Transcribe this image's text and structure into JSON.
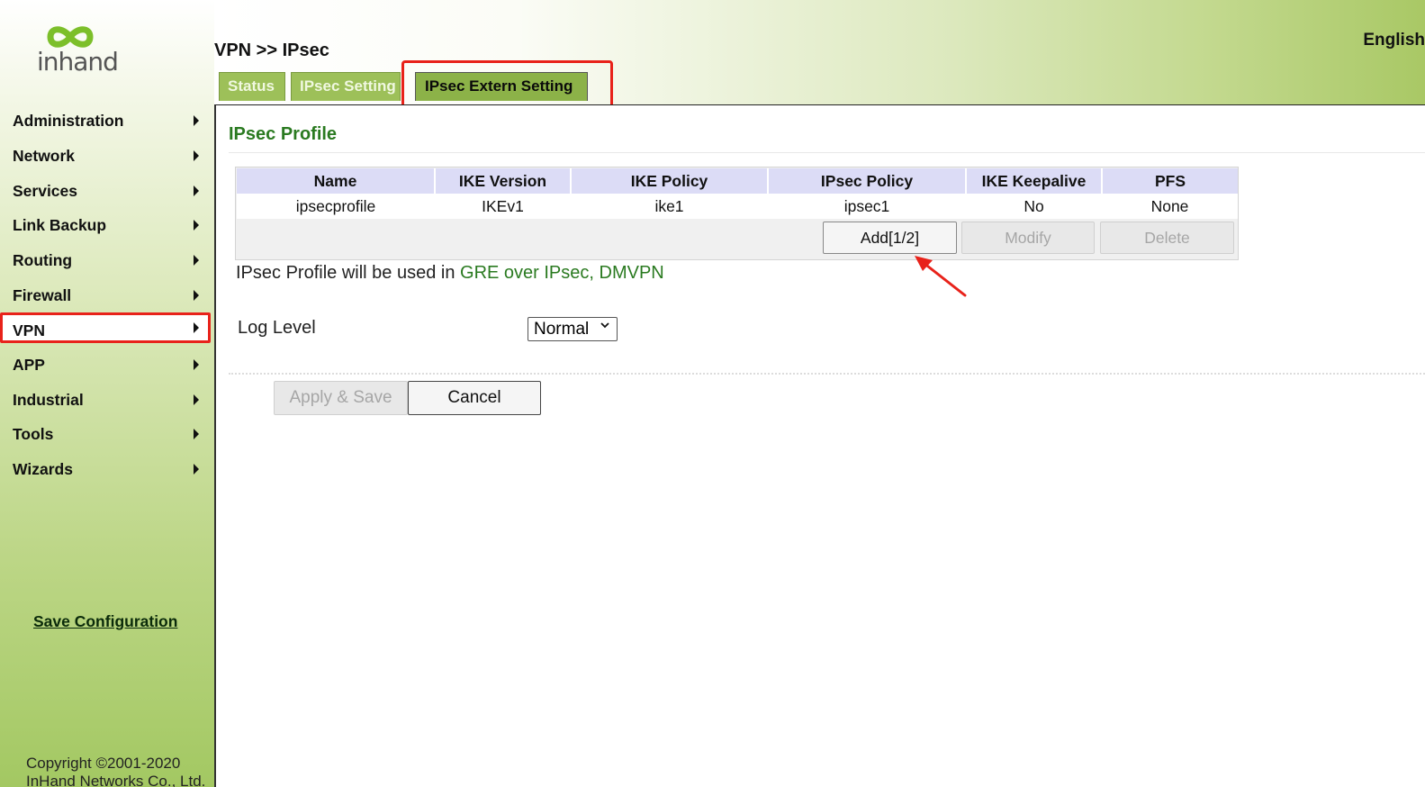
{
  "brand": {
    "logo_text": "inhand"
  },
  "header": {
    "breadcrumb": "VPN >> IPsec",
    "language": "English"
  },
  "tabs": [
    {
      "label": "Status",
      "active": false
    },
    {
      "label": "IPsec Setting",
      "active": false
    },
    {
      "label": "IPsec Extern Setting",
      "active": true
    }
  ],
  "sidebar": {
    "items": [
      {
        "label": "Administration"
      },
      {
        "label": "Network"
      },
      {
        "label": "Services"
      },
      {
        "label": "Link Backup"
      },
      {
        "label": "Routing"
      },
      {
        "label": "Firewall"
      },
      {
        "label": "VPN",
        "active": true
      },
      {
        "label": "APP"
      },
      {
        "label": "Industrial"
      },
      {
        "label": "Tools"
      },
      {
        "label": "Wizards"
      }
    ],
    "save_label": "Save Configuration",
    "copyright_line1": "Copyright ©2001-2020",
    "copyright_line2": "InHand Networks Co., Ltd."
  },
  "profile": {
    "title": "IPsec Profile",
    "columns": [
      "Name",
      "IKE Version",
      "IKE Policy",
      "IPsec Policy",
      "IKE Keepalive",
      "PFS"
    ],
    "rows": [
      [
        "ipsecprofile",
        "IKEv1",
        "ike1",
        "ipsec1",
        "No",
        "None"
      ]
    ],
    "buttons": {
      "add": "Add[1/2]",
      "modify": "Modify",
      "delete": "Delete"
    },
    "note_prefix": "IPsec Profile will be used in ",
    "note_links": "GRE over IPsec, DMVPN"
  },
  "log_level": {
    "label": "Log Level",
    "selected": "Normal"
  },
  "actions": {
    "apply_label": "Apply & Save",
    "cancel_label": "Cancel"
  },
  "colors": {
    "accent_green": "#2a7a20",
    "tab_green": "#9dc059",
    "annotation_red": "#e8221a",
    "table_header": "#dcdcf6"
  }
}
